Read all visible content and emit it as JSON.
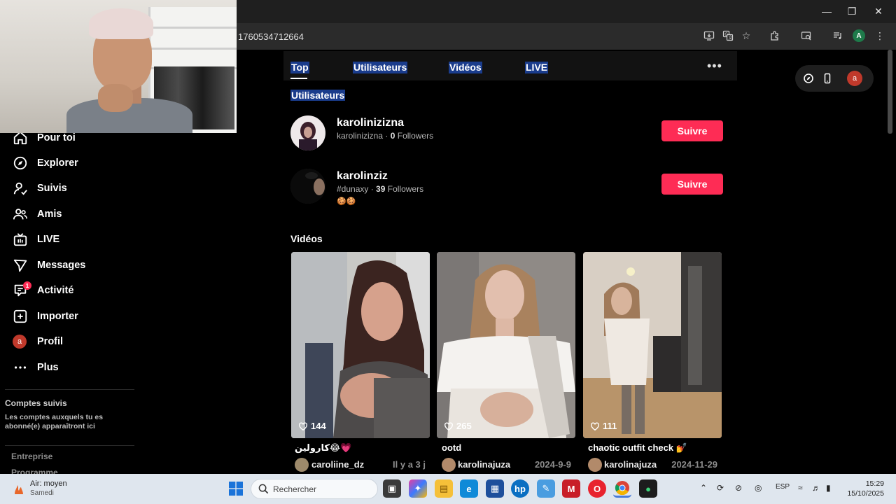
{
  "browser": {
    "url": "1760534712664",
    "account_initial": "A"
  },
  "tabs": [
    {
      "label": "Top"
    },
    {
      "label": "Utilisateurs"
    },
    {
      "label": "Vidéos"
    },
    {
      "label": "LIVE"
    }
  ],
  "sidebar": {
    "items": [
      {
        "label": "Pour toi",
        "icon": "home-icon"
      },
      {
        "label": "Explorer",
        "icon": "compass-icon"
      },
      {
        "label": "Suivis",
        "icon": "user-follow-icon"
      },
      {
        "label": "Amis",
        "icon": "friends-icon"
      },
      {
        "label": "LIVE",
        "icon": "live-tv-icon"
      },
      {
        "label": "Messages",
        "icon": "send-icon"
      },
      {
        "label": "Activité",
        "icon": "activity-icon",
        "badge": "1"
      },
      {
        "label": "Importer",
        "icon": "plus-square-icon"
      },
      {
        "label": "Profil",
        "icon": "profile-avatar",
        "avatar_initial": "a"
      },
      {
        "label": "Plus",
        "icon": "more-icon"
      }
    ],
    "followed_heading": "Comptes suivis",
    "followed_note": "Les comptes auxquels tu es abonné(e) apparaîtront ici",
    "footer_links": [
      "Entreprise",
      "Programme"
    ]
  },
  "sections": {
    "users_title": "Utilisateurs",
    "videos_title": "Vidéos"
  },
  "users": [
    {
      "name": "karolinizizna",
      "handle": "karolinizizna",
      "followers": "0",
      "followers_label": "Followers",
      "follow_label": "Suivre",
      "emoji": ""
    },
    {
      "name": "karolinziz",
      "handle": "#dunaxy",
      "followers": "39",
      "followers_label": "Followers",
      "follow_label": "Suivre",
      "emoji": "🍪🍪"
    }
  ],
  "videos": [
    {
      "likes": "144",
      "title": "كارولين😂💗",
      "author": "caroliine_dz",
      "date": "Il y a 3 j"
    },
    {
      "likes": "265",
      "title": "ootd",
      "author": "karolinajuza",
      "date": "2024-9-9"
    },
    {
      "likes": "111",
      "title": "chaotic outfit check 💅",
      "author": "karolinajuza",
      "date": "2024-11-29"
    }
  ],
  "top_right_avatar": "a",
  "taskbar": {
    "weather_line1": "Air: moyen",
    "weather_line2": "Samedi",
    "search_placeholder": "Rechercher",
    "lang": "ESP",
    "time": "15:29",
    "date": "15/10/2025"
  },
  "colors": {
    "accent": "#fe2c55",
    "selection": "#1a3c8c",
    "background": "#000000"
  }
}
